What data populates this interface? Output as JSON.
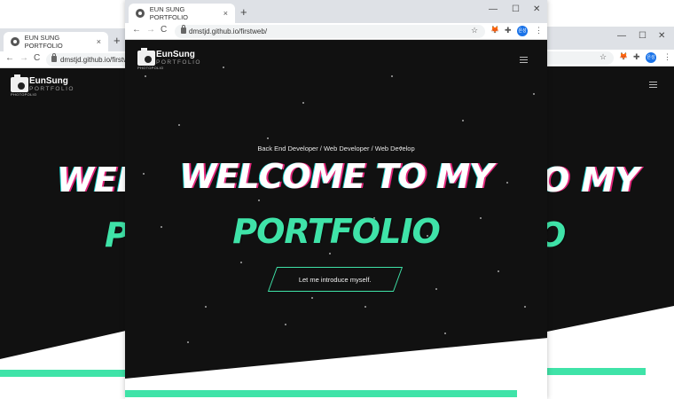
{
  "tab": {
    "title": "EUN SUNG PORTFOLIO",
    "close": "×",
    "new_tab": "+"
  },
  "window_controls": {
    "minimize": "—",
    "maximize": "☐",
    "close": "✕"
  },
  "nav": {
    "back": "←",
    "forward": "→",
    "reload": "C"
  },
  "address": {
    "url": "dmstjd.github.io/firstweb/",
    "url_left": "dmstjd.github.io/firstweb/",
    "url_right": ""
  },
  "toolbar_icons": {
    "star": "☆",
    "fox": "🦊",
    "puzzle": "✚",
    "more": "⋮",
    "avatar": "은성"
  },
  "page": {
    "logo_name": "EunSung",
    "logo_sub": "PORTFOLIO",
    "logo_badge": "PHOTOPOLIO",
    "tagline": "Back End Developer / Web Developer / Web Develop",
    "headline_1": "WELCOME TO MY",
    "headline_2": "PORTFOLIO",
    "cta": "Let me introduce myself.",
    "right_headline_1": "O MY",
    "left_headline_1": "WEL"
  },
  "colors": {
    "accent": "#3fe3a8",
    "hero_bg": "#111111",
    "glitch": "#e3267b",
    "chrome_bg": "#dee1e6"
  }
}
